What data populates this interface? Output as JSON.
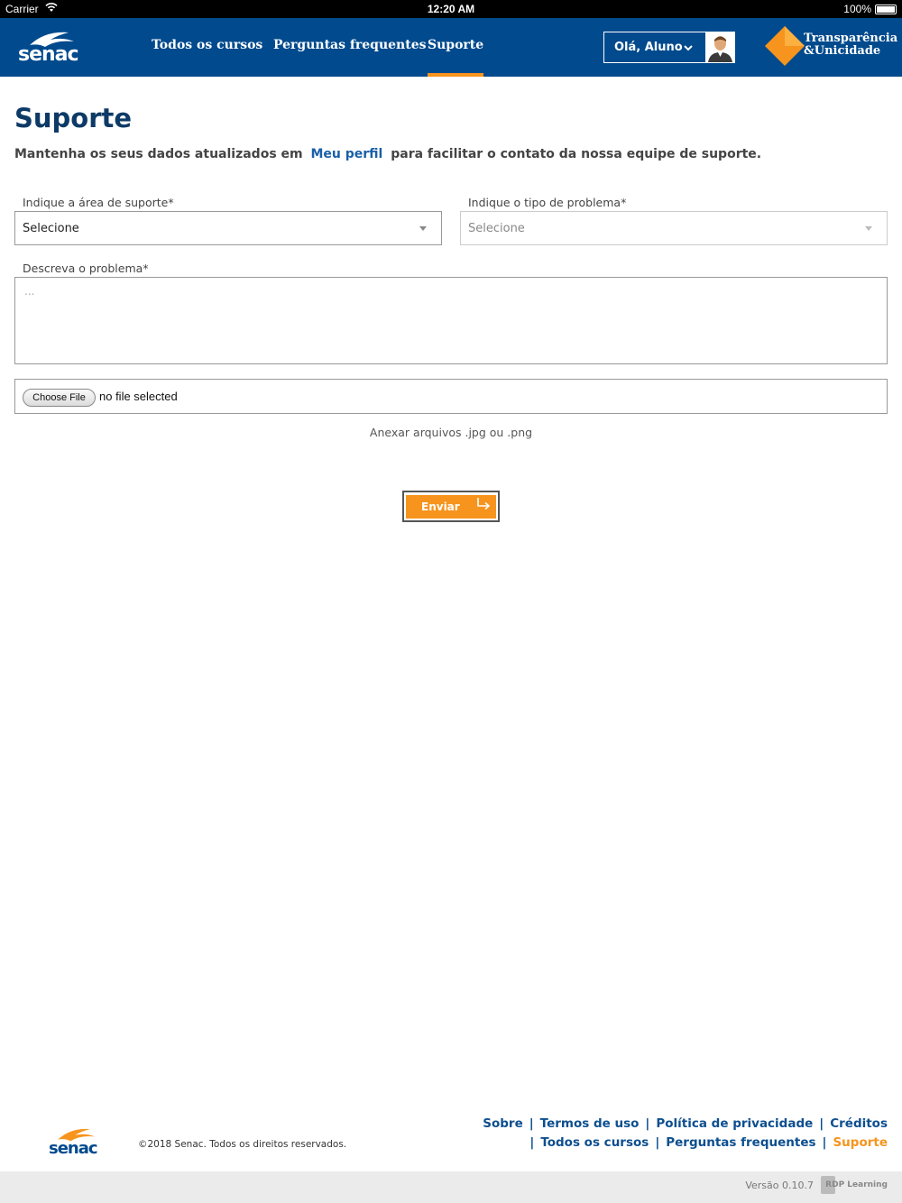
{
  "statusbar": {
    "carrier": "Carrier",
    "time": "12:20 AM",
    "battery": "100%"
  },
  "header": {
    "logo": "senac",
    "nav": [
      {
        "label": "Todos os cursos"
      },
      {
        "label": "Perguntas frequentes"
      },
      {
        "label": "Suporte",
        "active": true
      }
    ],
    "user_greeting": "Olá, Aluno",
    "brand_line1": "Transparência",
    "brand_line2": "&Unicidade"
  },
  "page": {
    "title": "Suporte",
    "intro_before": "Mantenha os seus dados atualizados em",
    "intro_link": "Meu perfil",
    "intro_after": "para facilitar o contato da nossa equipe de suporte."
  },
  "form": {
    "area_label": "Indique a área de suporte*",
    "area_value": "Selecione",
    "type_label": "Indique o tipo de problema*",
    "type_value": "Selecione",
    "desc_label": "Descreva o problema*",
    "desc_placeholder": "...",
    "file_button": "Choose File",
    "file_status": "no file selected",
    "file_hint": "Anexar arquivos .jpg ou .png",
    "submit": "Enviar"
  },
  "footer": {
    "logo": "senac",
    "copyright": "©2018 Senac. Todos os direitos reservados.",
    "links_row1": [
      "Sobre",
      "Termos de uso",
      "Política de privacidade",
      "Créditos"
    ],
    "links_row2": [
      "Todos os cursos",
      "Perguntas frequentes",
      "Suporte"
    ],
    "version": "Versão 0.10.7",
    "vendor": "RDP Learning"
  },
  "colors": {
    "primary": "#004a8d",
    "accent": "#f7941d"
  }
}
